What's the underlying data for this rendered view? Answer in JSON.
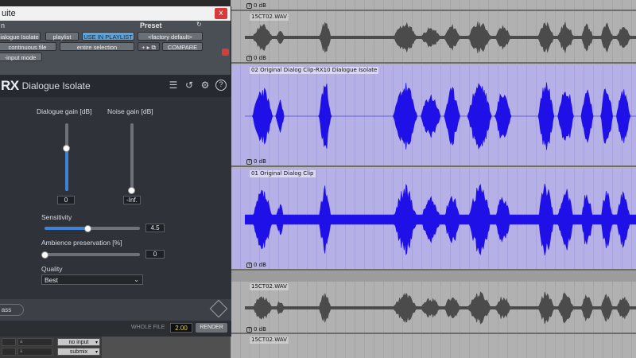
{
  "plugin": {
    "window_title": "uite",
    "close_label": "x",
    "header": {
      "left": "n",
      "preset": "Preset"
    },
    "row1": {
      "preset_name": "ialogue Isolate",
      "playlist": "playlist",
      "use_in_playlist": "USE IN PLAYLIST",
      "factory_default": "<factory default>"
    },
    "row2": {
      "mode": "continuous file",
      "selection": "entire selection",
      "compare": "COMPARE"
    },
    "row3": {
      "input_mode": "-input mode"
    },
    "rx_logo": "RX",
    "rx_name": "Dialogue Isolate",
    "dialogue_gain": {
      "label": "Dialogue gain [dB]",
      "value": "0",
      "level_fraction": 0.63
    },
    "noise_gain": {
      "label": "Noise gain [dB]",
      "value": "-Inf.",
      "level_fraction": 0.0
    },
    "sensitivity": {
      "label": "Sensitivity",
      "value": "4.5",
      "level_fraction": 0.45
    },
    "ambience": {
      "label": "Ambience preservation [%]",
      "value": "0",
      "level_fraction": 0.0
    },
    "quality": {
      "label": "Quality",
      "selected": "Best"
    },
    "bypass_label": "ass",
    "whole_file_label": "WHOLE FILE",
    "whole_file_value": "2.00",
    "render_label": "RENDER"
  },
  "tracks": [
    {
      "name": "",
      "db": "0 dB",
      "color": "grey"
    },
    {
      "name": "15CT02.WAV",
      "db": "0 dB",
      "color": "grey"
    },
    {
      "name": "02 Original Dialog Clip-RX10 Dialogue Isolate",
      "db": "0 dB",
      "color": "blue"
    },
    {
      "name": "01 Original Dialog Clip",
      "db": "0 dB",
      "color": "blue"
    },
    {
      "name": "15CT02.WAV",
      "db": "0 dB",
      "color": "grey"
    },
    {
      "name": "15CT02.WAV",
      "db": "",
      "color": "grey"
    }
  ],
  "mixer": {
    "input": "no input",
    "output": "submix"
  },
  "colors": {
    "wave_blue": "#1f10e8",
    "wave_grey": "#4b4b4b",
    "accent": "#3d82d4"
  }
}
